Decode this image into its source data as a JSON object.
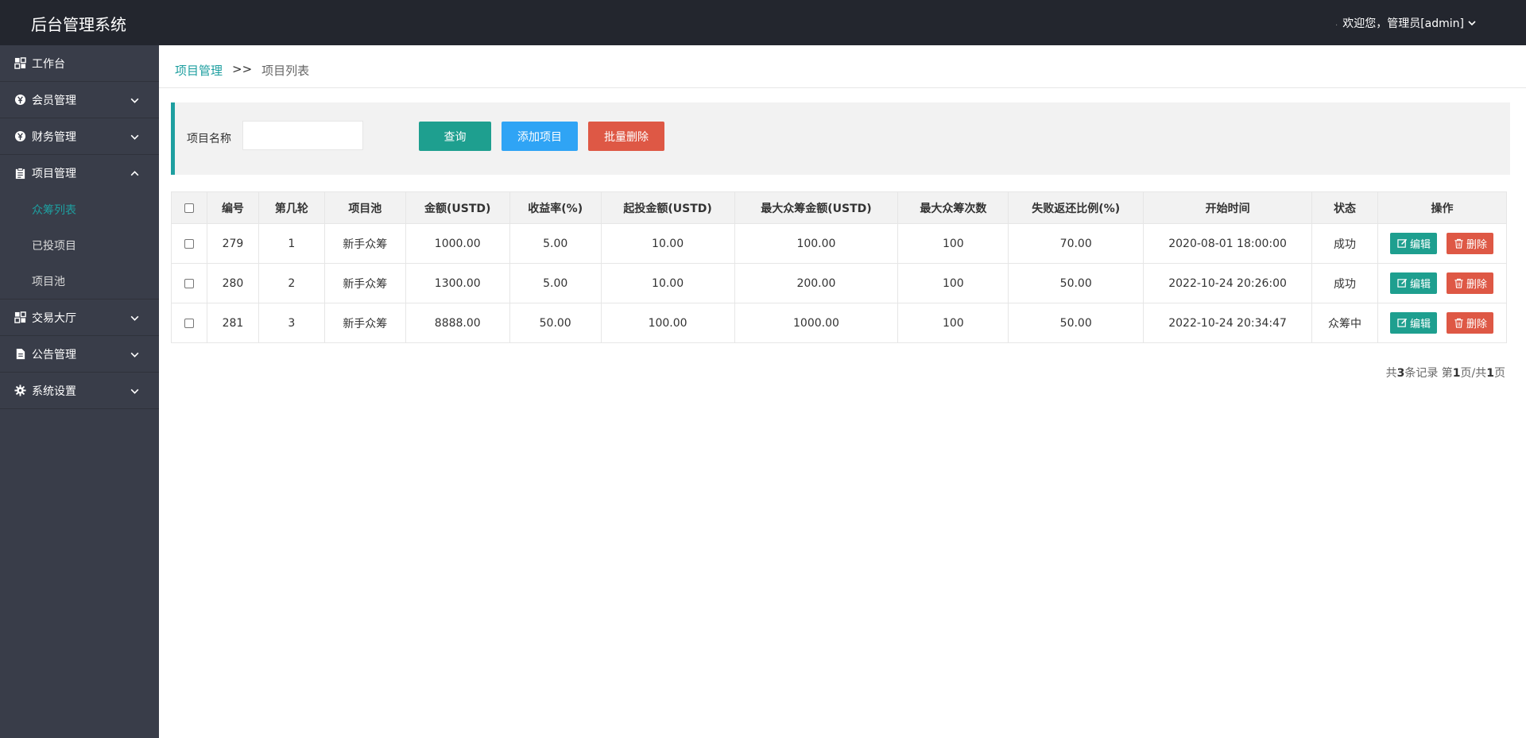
{
  "header": {
    "title": "后台管理系统",
    "welcome": "欢迎您，管理员[admin]"
  },
  "sidebar": {
    "items": [
      {
        "label": "工作台",
        "icon": "dashboard-icon"
      },
      {
        "label": "会员管理",
        "icon": "yen-circle-icon"
      },
      {
        "label": "财务管理",
        "icon": "yen-circle-icon"
      },
      {
        "label": "项目管理",
        "icon": "clipboard-icon",
        "expanded": true,
        "children": [
          {
            "label": "众筹列表",
            "active": true
          },
          {
            "label": "已投项目"
          },
          {
            "label": "项目池"
          }
        ]
      },
      {
        "label": "交易大厅",
        "icon": "dashboard-icon"
      },
      {
        "label": "公告管理",
        "icon": "document-icon"
      },
      {
        "label": "系统设置",
        "icon": "gear-icon"
      }
    ]
  },
  "breadcrumb": {
    "parent": "项目管理",
    "separator": ">>",
    "current": "项目列表"
  },
  "search": {
    "label": "项目名称",
    "value": "",
    "query_label": "查询",
    "add_label": "添加项目",
    "batch_delete_label": "批量删除"
  },
  "table": {
    "headers": [
      "编号",
      "第几轮",
      "项目池",
      "金额(USTD)",
      "收益率(%)",
      "起投金额(USTD)",
      "最大众筹金额(USTD)",
      "最大众筹次数",
      "失败返还比例(%)",
      "开始时间",
      "状态",
      "操作"
    ],
    "rows": [
      [
        "279",
        "1",
        "新手众筹",
        "1000.00",
        "5.00",
        "10.00",
        "100.00",
        "100",
        "70.00",
        "2020-08-01 18:00:00",
        "成功"
      ],
      [
        "280",
        "2",
        "新手众筹",
        "1300.00",
        "5.00",
        "10.00",
        "200.00",
        "100",
        "50.00",
        "2022-10-24 20:26:00",
        "成功"
      ],
      [
        "281",
        "3",
        "新手众筹",
        "8888.00",
        "50.00",
        "100.00",
        "1000.00",
        "100",
        "50.00",
        "2022-10-24 20:34:47",
        "众筹中"
      ]
    ],
    "edit_label": "编辑",
    "delete_label": "删除"
  },
  "pager": {
    "p1": "共",
    "total": "3",
    "p2": "条记录 第",
    "page": "1",
    "p3": "页/共",
    "pages": "1",
    "p4": "页"
  }
}
